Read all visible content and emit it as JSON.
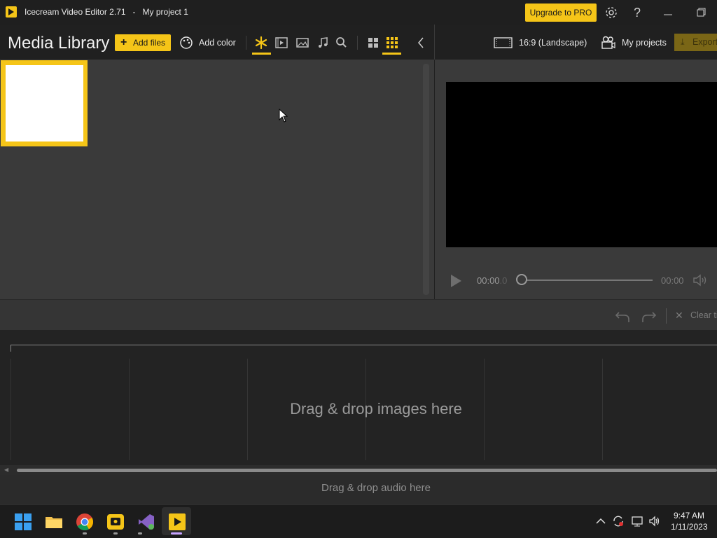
{
  "titlebar": {
    "app_title": "Icecream Video Editor 2.71   -   My project 1",
    "upgrade_label": "Upgrade to PRO"
  },
  "toolbar": {
    "media_title": "Media Library",
    "add_files_label": "Add files",
    "add_color_label": "Add color",
    "aspect_label": "16:9 (Landscape)",
    "my_projects_label": "My projects",
    "export_label": "Export"
  },
  "player": {
    "time_start": "00:00",
    "time_start_fraction": ".0",
    "time_end": "00:00"
  },
  "timeline": {
    "clear_label": "Clear timeline",
    "drop_images": "Drag & drop images here",
    "drop_audio": "Drag & drop audio here"
  },
  "taskbar": {
    "time": "9:47 AM",
    "date": "1/11/2023"
  },
  "icons": {
    "app": "icecream-logo-icon",
    "settings": "gear-icon",
    "help": "question-icon",
    "minimize": "minimize-icon",
    "restore": "restore-icon"
  },
  "colors": {
    "accent": "#f5c518",
    "panel": "#3a3a3a",
    "background": "#202020"
  }
}
